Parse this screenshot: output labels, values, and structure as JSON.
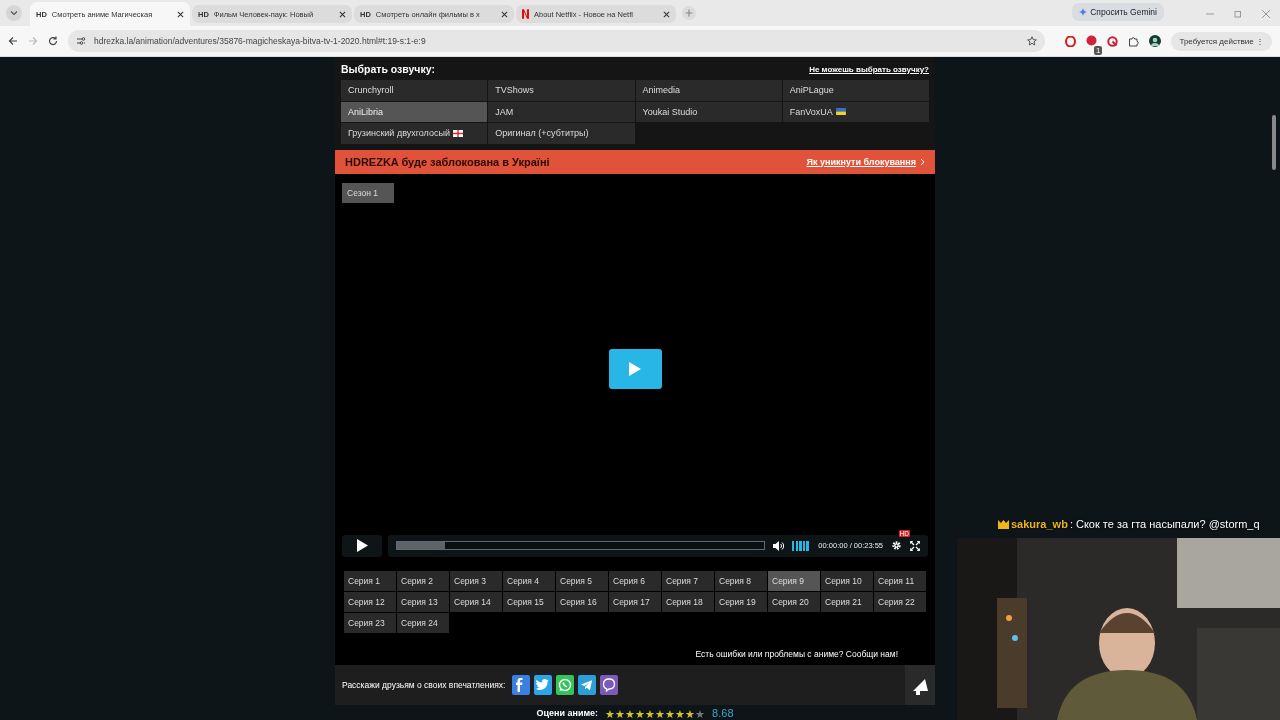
{
  "browser": {
    "tabs": [
      {
        "kind": "text-favicon",
        "favicon_text": "HD",
        "title": "Смотреть аниме Магическая",
        "selected": true
      },
      {
        "kind": "text-favicon",
        "favicon_text": "HD",
        "title": "Фильм Человек-паук: Новый",
        "selected": false
      },
      {
        "kind": "text-favicon",
        "favicon_text": "HD",
        "title": "Смотреть онлайн фильмы в х",
        "selected": false
      },
      {
        "kind": "netflix",
        "title": "About Netflix - Новое на Netfl",
        "selected": false
      }
    ],
    "address": "hdrezka.la/animation/adventures/35876-magicheskaya-bitva-tv-1-2020.html#t:19-s:1-e:9",
    "gemini_button": "Спросить Gemini",
    "extension_badge": "1",
    "profile_button": "Требуется действие",
    "profile_menu": "⋮"
  },
  "dubbing": {
    "title": "Выбрать озвучку:",
    "help_link": "Не можешь выбрать озвучку?",
    "options": [
      {
        "label": "Crunchyroll",
        "selected": false
      },
      {
        "label": "TVShows",
        "selected": false
      },
      {
        "label": "Animedia",
        "selected": false
      },
      {
        "label": "AniPLague",
        "selected": false
      },
      {
        "label": "AniLibria",
        "selected": true
      },
      {
        "label": "JAM",
        "selected": false
      },
      {
        "label": "Youkai Studio",
        "selected": false
      },
      {
        "label": "FanVoxUA",
        "selected": false,
        "kind": "ua-flag"
      },
      {
        "label": "Грузинский двухголосый",
        "selected": false,
        "kind": "ge-flag"
      },
      {
        "label": "Оригинал (+субтитры)",
        "selected": false
      }
    ]
  },
  "banner": {
    "text": "HDREZKA буде заблокована в Україні",
    "link": "Як уникнути блокування"
  },
  "seasons": [
    {
      "label": "Сезон 1",
      "selected": true
    }
  ],
  "player": {
    "progress": {
      "level": 0.13
    },
    "volume": {
      "level": 1
    },
    "time": "00:00:00 / 00:23:55",
    "quality_badge": "HD"
  },
  "episodes": [
    {
      "label": "Серия 1",
      "selected": false
    },
    {
      "label": "Серия 2",
      "selected": false
    },
    {
      "label": "Серия 3",
      "selected": false
    },
    {
      "label": "Серия 4",
      "selected": false
    },
    {
      "label": "Серия 5",
      "selected": false
    },
    {
      "label": "Серия 6",
      "selected": false
    },
    {
      "label": "Серия 7",
      "selected": false
    },
    {
      "label": "Серия 8",
      "selected": false
    },
    {
      "label": "Серия 9",
      "selected": true
    },
    {
      "label": "Серия 10",
      "selected": false
    },
    {
      "label": "Серия 11",
      "selected": false
    },
    {
      "label": "Серия 12",
      "selected": false
    },
    {
      "label": "Серия 13",
      "selected": false
    },
    {
      "label": "Серия 14",
      "selected": false
    },
    {
      "label": "Серия 15",
      "selected": false
    },
    {
      "label": "Серия 16",
      "selected": false
    },
    {
      "label": "Серия 17",
      "selected": false
    },
    {
      "label": "Серия 18",
      "selected": false
    },
    {
      "label": "Серия 19",
      "selected": false
    },
    {
      "label": "Серия 20",
      "selected": false
    },
    {
      "label": "Серия 21",
      "selected": false
    },
    {
      "label": "Серия 22",
      "selected": false
    },
    {
      "label": "Серия 23",
      "selected": false
    },
    {
      "label": "Серия 24",
      "selected": false
    }
  ],
  "report": "Есть ошибки или проблемы с аниме? Сообщи нам!",
  "share": {
    "label": "Расскажи друзьям о своих впечатлениях:",
    "networks": [
      {
        "kind": "facebook",
        "color": "#3b7fe0"
      },
      {
        "kind": "twitter",
        "color": "#2da4e8"
      },
      {
        "kind": "whatsapp",
        "color": "#34c45a"
      },
      {
        "kind": "telegram",
        "color": "#2c9fd8"
      },
      {
        "kind": "viber",
        "color": "#7a5bb8"
      }
    ]
  },
  "rating": {
    "label": "Оцени аниме:",
    "stars": 9,
    "value": "8.68"
  },
  "stream": {
    "chat": {
      "user": "sakura_wb",
      "message": ": Скок те за гта насыпали? @storm_q"
    }
  }
}
